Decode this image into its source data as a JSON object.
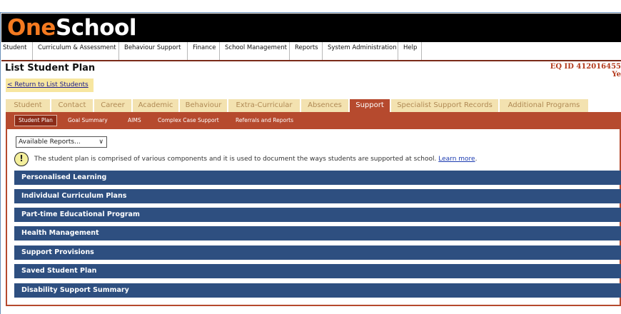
{
  "app": {
    "logo_one": "One",
    "logo_school": "School"
  },
  "menu": [
    "Student",
    "Curriculum & Assessment",
    "Behaviour Support",
    "Finance",
    "School Management",
    "Reports",
    "System Administration",
    "Help"
  ],
  "page": {
    "title": "List Student Plan",
    "eq_id": "EQ ID  412016455",
    "eq_line2": "Ye",
    "return_link": "< Return to List Students"
  },
  "tabs": {
    "items": [
      "Student",
      "Contact",
      "Career",
      "Academic",
      "Behaviour",
      "Extra-Curricular",
      "Absences",
      "Support",
      "Specialist Support Records",
      "Additional Programs"
    ],
    "active": "Support"
  },
  "subtabs": {
    "items": [
      "Student Plan",
      "Goal Summary",
      "AIMS",
      "Complex Case Support",
      "Referrals and Reports"
    ],
    "active": "Student Plan"
  },
  "reports_select": {
    "value": "Available Reports..."
  },
  "notice": {
    "text": "The student plan is comprised of various components and it is used to document the ways students are supported at school.",
    "link": "Learn more",
    "trailing": "."
  },
  "sections": [
    "Personalised Learning",
    "Individual Curriculum Plans",
    "Part-time Educational Program",
    "Health Management",
    "Support Provisions",
    "Saved Student Plan",
    "Disability Support Summary"
  ],
  "colors": {
    "brand_orange": "#f47a20",
    "header_black": "#000000",
    "active_tab": "#b64a2e",
    "section_blue": "#2e4f80",
    "eq_red": "#b33a1c"
  }
}
